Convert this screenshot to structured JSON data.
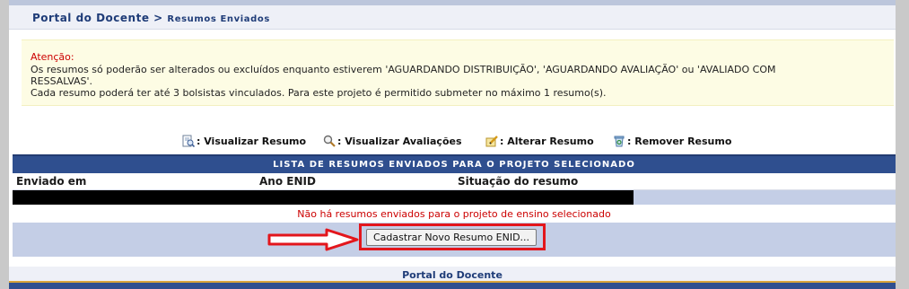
{
  "header": {
    "title_main": "Portal do Docente",
    "title_sep": " > ",
    "title_section": "Resumos Enviados"
  },
  "warning": {
    "label": "Atenção:",
    "line1": "Os resumos só poderão ser alterados ou excluídos enquanto estiverem 'AGUARDANDO DISTRIBUIÇÃO', 'AGUARDANDO AVALIAÇÃO' ou 'AVALIADO COM",
    "line2": "RESSALVAS'.",
    "line3": "Cada resumo poderá ter até 3 bolsistas vinculados. Para este projeto é permitido submeter no máximo 1 resumo(s)."
  },
  "legend": {
    "view_summary": ": Visualizar Resumo",
    "view_evaluations": ": Visualizar Avaliações",
    "edit_summary": ": Alterar Resumo",
    "remove_summary": ": Remover Resumo"
  },
  "table": {
    "caption": "LISTA DE RESUMOS ENVIADOS PARA O PROJETO SELECIONADO",
    "columns": [
      "Enviado em",
      "Ano ENID",
      "Situação do resumo"
    ],
    "empty_message": "Não há resumos enviados para o projeto de ensino selecionado",
    "register_button": "Cadastrar Novo Resumo ENID..."
  },
  "footer": {
    "label": "Portal do Docente"
  },
  "colors": {
    "header_text": "#1f3c78",
    "table_caption_bg": "#2f4f8f",
    "warning_bg": "#fdfce4",
    "warning_label": "#cc0000",
    "highlight": "#e3161c"
  }
}
